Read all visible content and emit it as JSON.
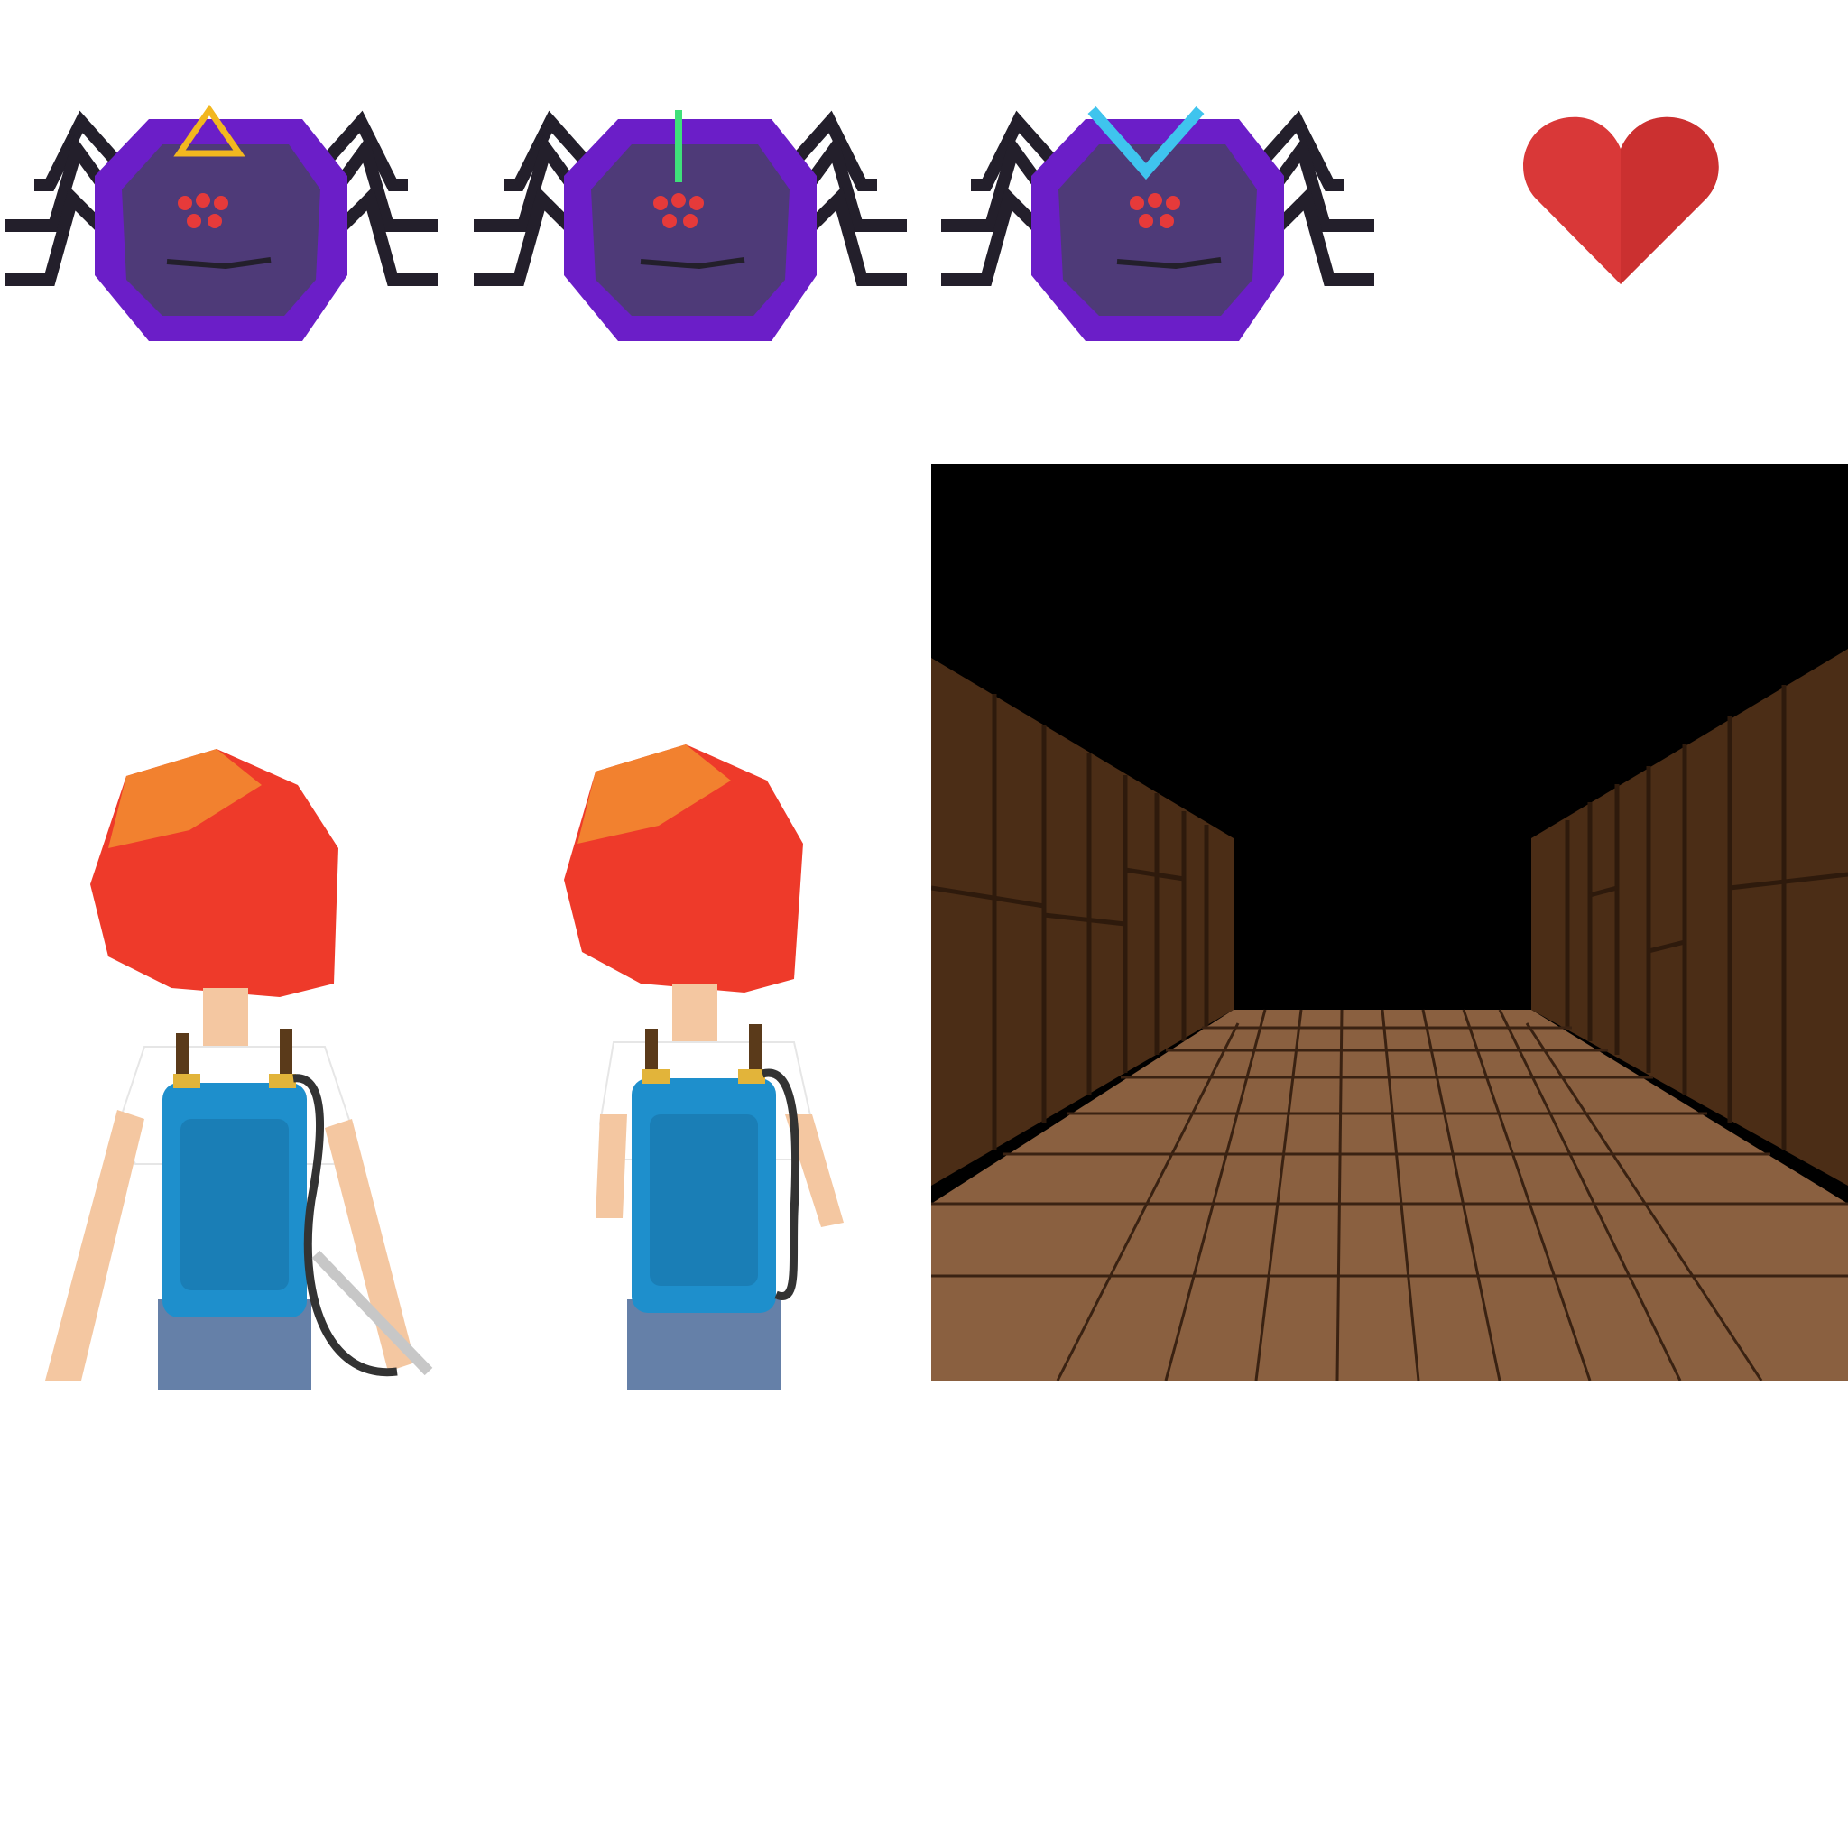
{
  "spiders": [
    {
      "name": "spider-triangle",
      "symbol": "triangle",
      "symbol_color": "#F2B71F"
    },
    {
      "name": "spider-line",
      "symbol": "vertical-line",
      "symbol_color": "#3FE07A"
    },
    {
      "name": "spider-chevron",
      "symbol": "chevron-down",
      "symbol_color": "#3FC4EE"
    }
  ],
  "colors": {
    "spider_shell": "#6B1EC8",
    "spider_face": "#4E3A78",
    "spider_legs": "#231F2B",
    "spider_eyes": "#E63A3A",
    "heart": "#D93838",
    "hair": "#EE3A2A",
    "backpack": "#1E8FCC",
    "skin": "#F4C7A1",
    "shorts": "#6580A8",
    "floor": "#8A6040",
    "wall": "#4B2D16"
  },
  "icons": {
    "heart": "heart-icon"
  }
}
